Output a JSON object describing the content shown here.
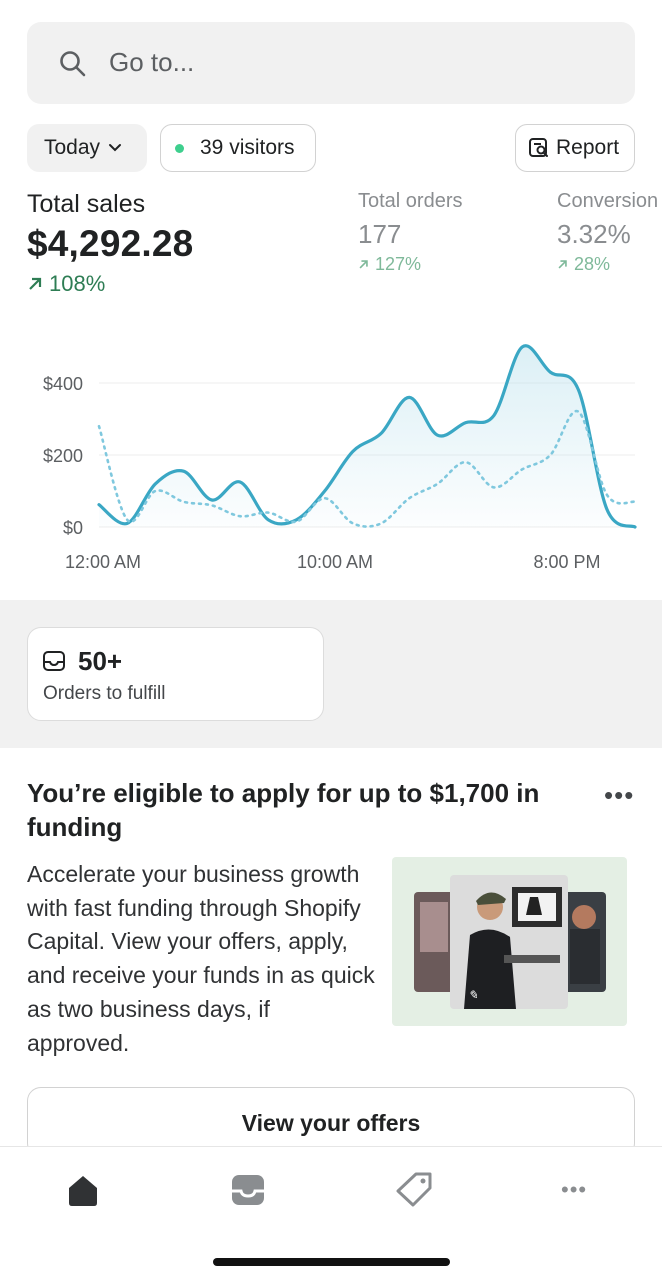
{
  "search": {
    "placeholder": "Go to...",
    "icon": "search-icon"
  },
  "filters": {
    "date_label": "Today",
    "visitors_label": "39 visitors",
    "visitors_dot_color": "#3ecf8e",
    "report_label": "Report"
  },
  "metrics": {
    "total_sales": {
      "label": "Total sales",
      "value": "$4,292.28",
      "change": "108%"
    },
    "total_orders": {
      "label": "Total orders",
      "value": "177",
      "change": "127%"
    },
    "conversion": {
      "label": "Conversion",
      "value": "3.32%",
      "change": "28%"
    }
  },
  "chart_data": {
    "type": "line",
    "y_ticks": [
      "$400",
      "$200",
      "$0"
    ],
    "x_ticks": [
      "12:00 AM",
      "10:00 AM",
      "8:00 PM"
    ],
    "ylim": [
      0,
      550
    ],
    "series": [
      {
        "style": "solid",
        "color": "#3aa7c4",
        "values": [
          62,
          10,
          120,
          155,
          75,
          125,
          20,
          20,
          100,
          210,
          260,
          360,
          255,
          290,
          310,
          500,
          430,
          380,
          50,
          0
        ]
      },
      {
        "style": "dotted",
        "color": "#7fc8de",
        "values": [
          280,
          20,
          100,
          70,
          60,
          30,
          40,
          15,
          80,
          10,
          10,
          80,
          120,
          180,
          110,
          160,
          200,
          320,
          90,
          70
        ]
      }
    ]
  },
  "fulfill": {
    "count": "50+",
    "label": "Orders to fulfill"
  },
  "funding": {
    "title": "You’re eligible to apply for up to $1,700 in funding",
    "body": "Accelerate your business growth with fast funding through Shopify Capital. View your offers, apply, and receive your funds in as quick as two business days, if approved.",
    "more_label": "•••",
    "button_label": "View your offers"
  },
  "tabbar": {
    "items": [
      {
        "icon": "home-icon"
      },
      {
        "icon": "orders-inbox-icon"
      },
      {
        "icon": "products-tag-icon"
      },
      {
        "icon": "more-icon",
        "label": "•••"
      }
    ]
  }
}
